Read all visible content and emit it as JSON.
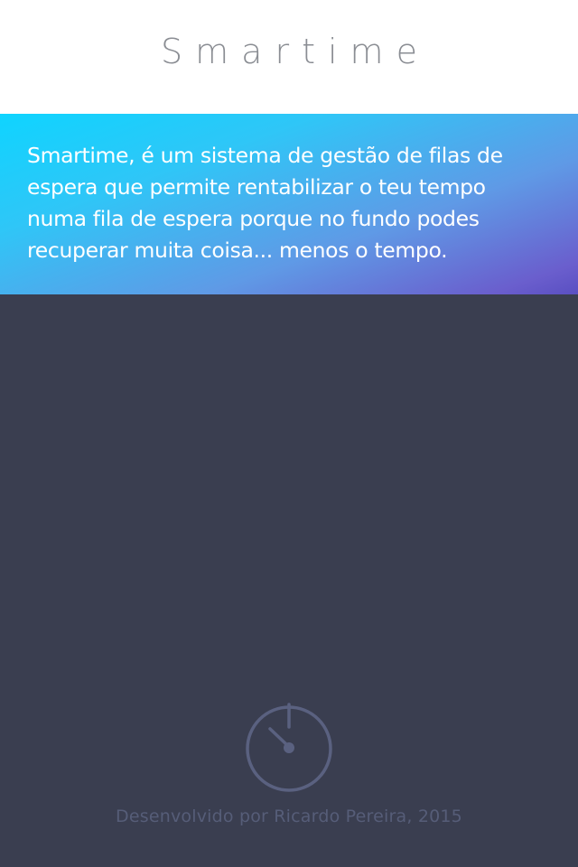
{
  "header": {
    "title": "Smartime"
  },
  "hero": {
    "description": "Smartime, é um sistema de gestão de filas de espera que permite rentabilizar o teu tempo numa fila de espera porque no fundo podes recuperar muita coisa... menos o tempo."
  },
  "main": {
    "icon": "timer-icon",
    "footer_credit": "Desenvolvido por Ricardo Pereira, 2015"
  },
  "colors": {
    "header_bg": "#ffffff",
    "title_text": "#8a8d93",
    "gradient_start": "#0fd4ff",
    "gradient_end": "#5a4fc2",
    "main_bg": "#3a3e50",
    "icon_stroke": "#5a6180",
    "credit_text": "#565d78"
  }
}
